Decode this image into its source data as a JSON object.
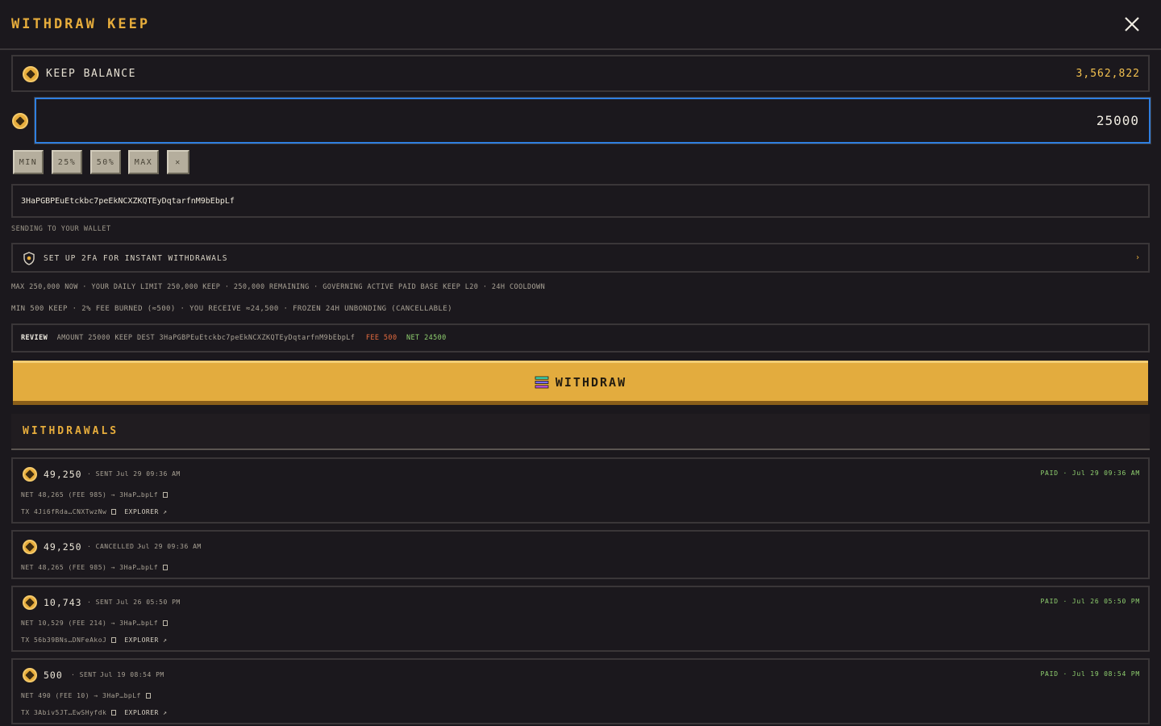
{
  "header": {
    "title": "WITHDRAW KEEP"
  },
  "balance": {
    "label": "KEEP BALANCE",
    "value": "3,562,822"
  },
  "amount": {
    "value": "25000"
  },
  "chips": [
    "MIN",
    "25%",
    "50%",
    "MAX",
    "✕"
  ],
  "address": {
    "value": "3HaPGBPEuEtckbc7peEkNCXZKQTEyDqtarfnM9bEbpLf"
  },
  "sending_note": "SENDING TO YOUR WALLET",
  "twofa": {
    "label": "SET UP 2FA FOR INSTANT WITHDRAWALS",
    "chevron": "›"
  },
  "info": {
    "limits": "MAX 250,000 NOW · YOUR DAILY LIMIT 250,000 KEEP · 250,000 REMAINING · GOVERNING ACTIVE PAID BASE KEEP L20 · 24H COOLDOWN",
    "fees": "MIN 500 KEEP · 2% FEE BURNED (≈500) · YOU RECEIVE ≈24,500 · FROZEN 24H UNBONDING (CANCELLABLE)"
  },
  "review": {
    "label": "REVIEW",
    "detail": "AMOUNT 25000 KEEP  DEST 3HaPGBPEuEtckbc7peEkNCXZKQTEyDqtarfnM9bEbpLf",
    "fee": "FEE 500",
    "net": "NET 24500"
  },
  "withdraw_button": {
    "label": "WITHDRAW"
  },
  "withdrawals": {
    "title": "WITHDRAWALS",
    "items": [
      {
        "amount": "49,250",
        "status": "· SENT ·",
        "date": "Jul 29 09:36 AM",
        "paid": "PAID · Jul 29 09:36 AM",
        "net": "NET 48,265 (FEE 985) → 3HaP…bpLf",
        "tx": "TX 4Ji6fRda…CNXTwzNw",
        "explorer": "EXPLORER ↗"
      },
      {
        "amount": "49,250",
        "status": "· CANCELLED ·",
        "date": "Jul 29 09:36 AM",
        "paid": "",
        "net": "NET 48,265 (FEE 985) → 3HaP…bpLf",
        "tx": "",
        "explorer": ""
      },
      {
        "amount": "10,743",
        "status": "· SENT ·",
        "date": "Jul 26 05:50 PM",
        "paid": "PAID · Jul 26 05:50 PM",
        "net": "NET 10,529 (FEE 214) → 3HaP…bpLf",
        "tx": "TX 56b39BNs…DNFeAkoJ",
        "explorer": "EXPLORER ↗"
      },
      {
        "amount": "500",
        "status": "· SENT ·",
        "date": "Jul 19 08:54 PM",
        "paid": "PAID · Jul 19 08:54 PM",
        "net": "NET 490 (FEE 10) → 3HaP…bpLf",
        "tx": "TX 3Abiv5JT…EwSHyfdk",
        "explorer": "EXPLORER ↗"
      }
    ]
  },
  "colors": {
    "accent": "#e3ac3e",
    "paid": "#8fcf6f",
    "fee": "#e46b3f",
    "focus": "#2f7fe0",
    "bg": "#1b181d"
  }
}
